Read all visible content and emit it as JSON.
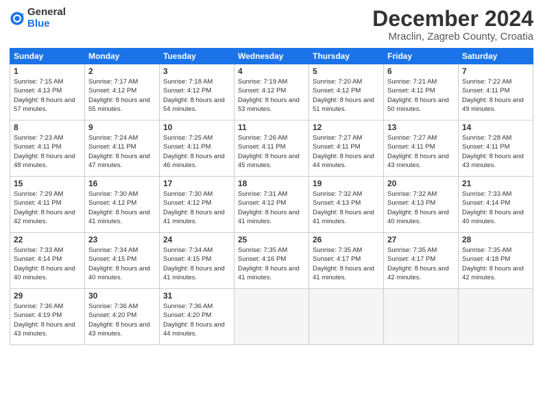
{
  "header": {
    "logo_general": "General",
    "logo_blue": "Blue",
    "title": "December 2024",
    "subtitle": "Mraclin, Zagreb County, Croatia"
  },
  "days_of_week": [
    "Sunday",
    "Monday",
    "Tuesday",
    "Wednesday",
    "Thursday",
    "Friday",
    "Saturday"
  ],
  "weeks": [
    [
      {
        "num": "1",
        "sunrise": "7:15 AM",
        "sunset": "4:13 PM",
        "daylight": "8 hours and 57 minutes."
      },
      {
        "num": "2",
        "sunrise": "7:17 AM",
        "sunset": "4:12 PM",
        "daylight": "8 hours and 55 minutes."
      },
      {
        "num": "3",
        "sunrise": "7:18 AM",
        "sunset": "4:12 PM",
        "daylight": "8 hours and 54 minutes."
      },
      {
        "num": "4",
        "sunrise": "7:19 AM",
        "sunset": "4:12 PM",
        "daylight": "8 hours and 53 minutes."
      },
      {
        "num": "5",
        "sunrise": "7:20 AM",
        "sunset": "4:12 PM",
        "daylight": "8 hours and 51 minutes."
      },
      {
        "num": "6",
        "sunrise": "7:21 AM",
        "sunset": "4:11 PM",
        "daylight": "8 hours and 50 minutes."
      },
      {
        "num": "7",
        "sunrise": "7:22 AM",
        "sunset": "4:11 PM",
        "daylight": "8 hours and 49 minutes."
      }
    ],
    [
      {
        "num": "8",
        "sunrise": "7:23 AM",
        "sunset": "4:11 PM",
        "daylight": "8 hours and 48 minutes."
      },
      {
        "num": "9",
        "sunrise": "7:24 AM",
        "sunset": "4:11 PM",
        "daylight": "8 hours and 47 minutes."
      },
      {
        "num": "10",
        "sunrise": "7:25 AM",
        "sunset": "4:11 PM",
        "daylight": "8 hours and 46 minutes."
      },
      {
        "num": "11",
        "sunrise": "7:26 AM",
        "sunset": "4:11 PM",
        "daylight": "8 hours and 45 minutes."
      },
      {
        "num": "12",
        "sunrise": "7:27 AM",
        "sunset": "4:11 PM",
        "daylight": "8 hours and 44 minutes."
      },
      {
        "num": "13",
        "sunrise": "7:27 AM",
        "sunset": "4:11 PM",
        "daylight": "8 hours and 43 minutes."
      },
      {
        "num": "14",
        "sunrise": "7:28 AM",
        "sunset": "4:11 PM",
        "daylight": "8 hours and 43 minutes."
      }
    ],
    [
      {
        "num": "15",
        "sunrise": "7:29 AM",
        "sunset": "4:11 PM",
        "daylight": "8 hours and 42 minutes."
      },
      {
        "num": "16",
        "sunrise": "7:30 AM",
        "sunset": "4:12 PM",
        "daylight": "8 hours and 41 minutes."
      },
      {
        "num": "17",
        "sunrise": "7:30 AM",
        "sunset": "4:12 PM",
        "daylight": "8 hours and 41 minutes."
      },
      {
        "num": "18",
        "sunrise": "7:31 AM",
        "sunset": "4:12 PM",
        "daylight": "8 hours and 41 minutes."
      },
      {
        "num": "19",
        "sunrise": "7:32 AM",
        "sunset": "4:13 PM",
        "daylight": "8 hours and 41 minutes."
      },
      {
        "num": "20",
        "sunrise": "7:32 AM",
        "sunset": "4:13 PM",
        "daylight": "8 hours and 40 minutes."
      },
      {
        "num": "21",
        "sunrise": "7:33 AM",
        "sunset": "4:14 PM",
        "daylight": "8 hours and 40 minutes."
      }
    ],
    [
      {
        "num": "22",
        "sunrise": "7:33 AM",
        "sunset": "4:14 PM",
        "daylight": "8 hours and 40 minutes."
      },
      {
        "num": "23",
        "sunrise": "7:34 AM",
        "sunset": "4:15 PM",
        "daylight": "8 hours and 40 minutes."
      },
      {
        "num": "24",
        "sunrise": "7:34 AM",
        "sunset": "4:15 PM",
        "daylight": "8 hours and 41 minutes."
      },
      {
        "num": "25",
        "sunrise": "7:35 AM",
        "sunset": "4:16 PM",
        "daylight": "8 hours and 41 minutes."
      },
      {
        "num": "26",
        "sunrise": "7:35 AM",
        "sunset": "4:17 PM",
        "daylight": "8 hours and 41 minutes."
      },
      {
        "num": "27",
        "sunrise": "7:35 AM",
        "sunset": "4:17 PM",
        "daylight": "8 hours and 42 minutes."
      },
      {
        "num": "28",
        "sunrise": "7:35 AM",
        "sunset": "4:18 PM",
        "daylight": "8 hours and 42 minutes."
      }
    ],
    [
      {
        "num": "29",
        "sunrise": "7:36 AM",
        "sunset": "4:19 PM",
        "daylight": "8 hours and 43 minutes."
      },
      {
        "num": "30",
        "sunrise": "7:36 AM",
        "sunset": "4:20 PM",
        "daylight": "8 hours and 43 minutes."
      },
      {
        "num": "31",
        "sunrise": "7:36 AM",
        "sunset": "4:20 PM",
        "daylight": "8 hours and 44 minutes."
      },
      null,
      null,
      null,
      null
    ]
  ]
}
